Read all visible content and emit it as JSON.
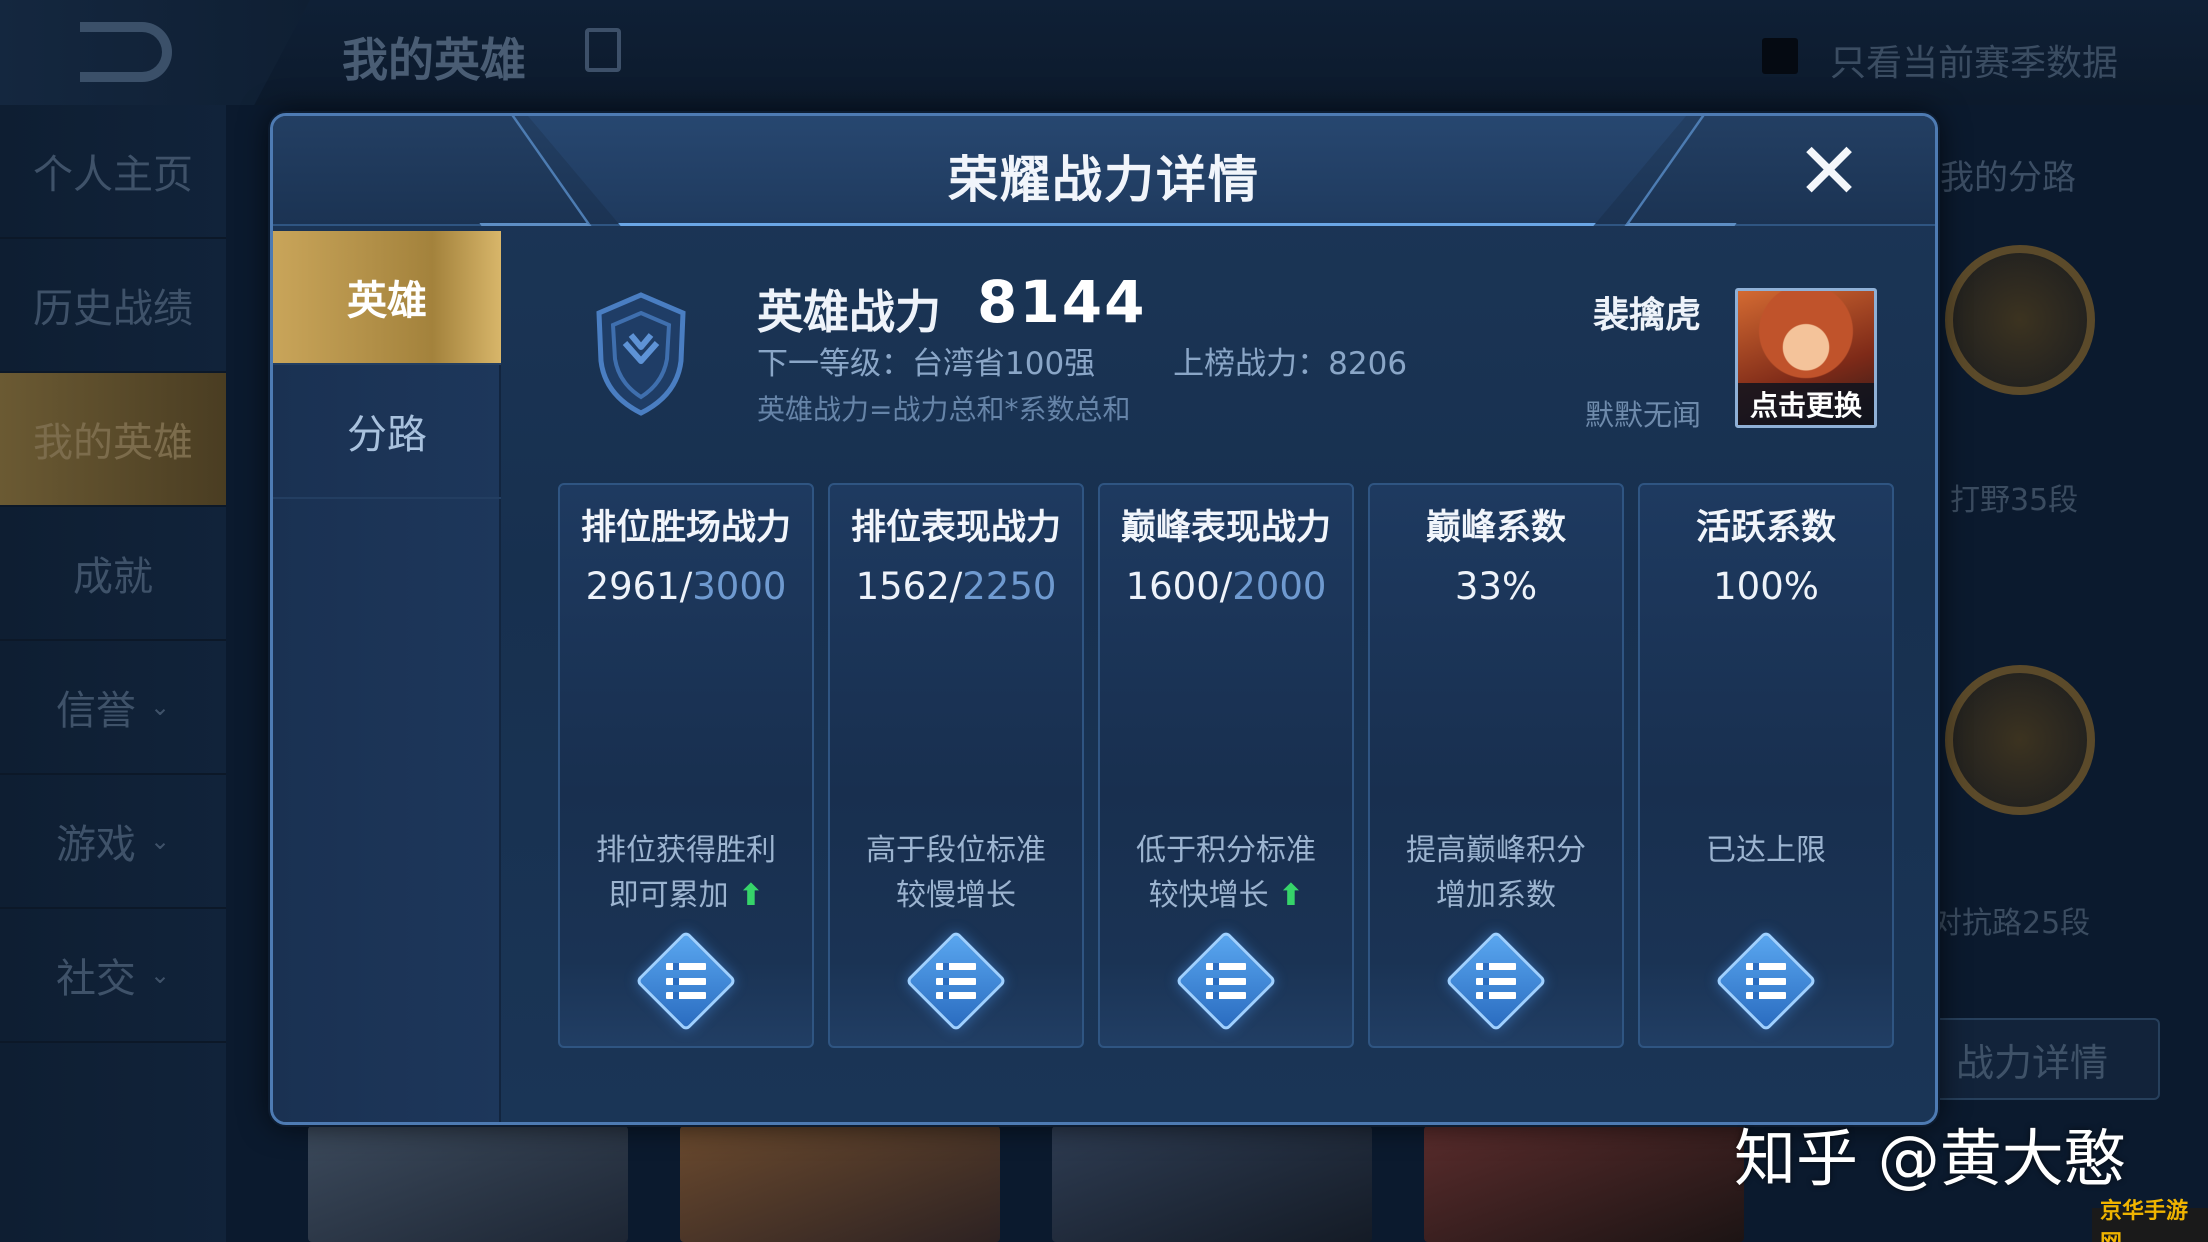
{
  "background": {
    "title": "我的英雄",
    "season_filter_label": "只看当前赛季数据",
    "side_menu": [
      {
        "label": "个人主页",
        "chevron": false
      },
      {
        "label": "历史战绩",
        "chevron": false
      },
      {
        "label": "我的英雄",
        "chevron": false,
        "active": true
      },
      {
        "label": "成就",
        "chevron": false
      },
      {
        "label": "信誉",
        "chevron": true
      },
      {
        "label": "游戏",
        "chevron": true
      },
      {
        "label": "社交",
        "chevron": true
      }
    ],
    "right_panel": {
      "title": "我的分路",
      "lanes": [
        {
          "label": "打野35段"
        },
        {
          "label": "对抗路25段"
        }
      ],
      "button_label": "战力详情"
    }
  },
  "modal": {
    "title": "荣耀战力详情",
    "close_symbol": "✕",
    "tabs": [
      {
        "label": "英雄",
        "active": true
      },
      {
        "label": "分路",
        "active": false
      }
    ],
    "summary": {
      "power_label": "英雄战力",
      "power_value": "8144",
      "next_level": "下一等级：台湾省100强",
      "rank_power": "上榜战力：8206",
      "formula": "英雄战力=战力总和*系数总和"
    },
    "hero": {
      "name": "裴擒虎",
      "subtitle": "默默无闻",
      "change_label": "点击更换"
    },
    "cards": [
      {
        "title": "排位胜场战力",
        "current": "2961",
        "max": "3000",
        "desc1": "排位获得胜利",
        "desc2": "即可累加",
        "arrow": "⬆"
      },
      {
        "title": "排位表现战力",
        "current": "1562",
        "max": "2250",
        "desc1": "高于段位标准",
        "desc2": "较慢增长",
        "arrow": ""
      },
      {
        "title": "巅峰表现战力",
        "current": "1600",
        "max": "2000",
        "desc1": "低于积分标准",
        "desc2": "较快增长",
        "arrow": "⬆"
      },
      {
        "title": "巅峰系数",
        "current": "33%",
        "max": "",
        "desc1": "提高巅峰积分",
        "desc2": "增加系数",
        "arrow": ""
      },
      {
        "title": "活跃系数",
        "current": "100%",
        "max": "",
        "desc1": "",
        "desc2": "已达上限",
        "arrow": ""
      }
    ]
  },
  "watermark": "知乎 @黄大憨",
  "site_mark": "京华手游网",
  "colors": {
    "accent_gold": "#c9a55a",
    "modal_border": "#4e7bb3",
    "increase_arrow": "#36d46a",
    "max_value": "#6f9ad0"
  }
}
